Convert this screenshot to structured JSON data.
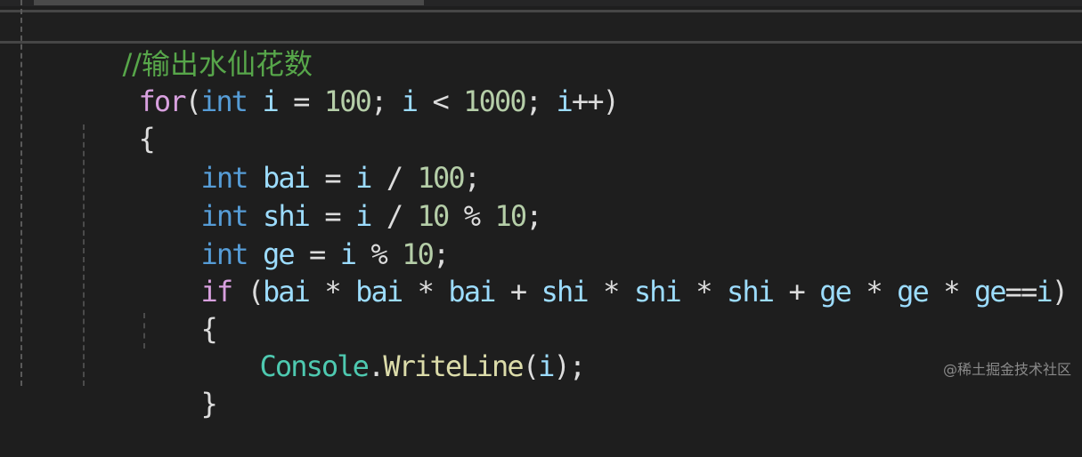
{
  "editor": {
    "comment": "//输出水仙花数",
    "lines": {
      "for": {
        "kw": "for",
        "open": "(",
        "int": "int",
        "var_i": "i",
        "eq": " = ",
        "n100": "100",
        "semi1": "; ",
        "var_i2": "i",
        "lt": " < ",
        "n1000": "1000",
        "semi2": "; ",
        "var_i3": "i",
        "inc": "++",
        "close": ")"
      },
      "brace_open": "{",
      "bai": {
        "kw": "int",
        "name": "bai",
        "eq": " = ",
        "i": "i",
        "div": " / ",
        "num": "100",
        "end": ";"
      },
      "shi": {
        "kw": "int",
        "name": "shi",
        "eq": " = ",
        "i": "i",
        "div": " / ",
        "num1": "10",
        "mod": " % ",
        "num2": "10",
        "end": ";"
      },
      "ge": {
        "kw": "int",
        "name": "ge",
        "eq": " = ",
        "i": "i",
        "mod": " % ",
        "num": "10",
        "end": ";"
      },
      "if": {
        "kw": "if",
        "open": " (",
        "v1": "bai",
        "m1": " * ",
        "v2": "bai",
        "m2": " * ",
        "v3": "bai",
        "p1": " + ",
        "v4": "shi",
        "m3": " * ",
        "v5": "shi",
        "m4": " * ",
        "v6": "shi",
        "p2": " + ",
        "v7": "ge",
        "m5": " * ",
        "v8": "ge",
        "m6": " * ",
        "v9": "ge",
        "eqeq": "==",
        "v10": "i",
        "close": ")"
      },
      "if_brace_open": "{",
      "console": {
        "type": "Console",
        "dot": ".",
        "method": "WriteLine",
        "open": "(",
        "arg": "i",
        "close": ");"
      },
      "if_brace_close": "}"
    }
  },
  "watermark": "@稀土掘金技术社区",
  "colors": {
    "background": "#1e1e1e",
    "comment": "#57a64a",
    "control_keyword": "#d8a0df",
    "keyword": "#569cd6",
    "variable": "#9cdcfe",
    "number": "#b5cea8",
    "type": "#4ec9b0",
    "method": "#dcdcaa"
  }
}
